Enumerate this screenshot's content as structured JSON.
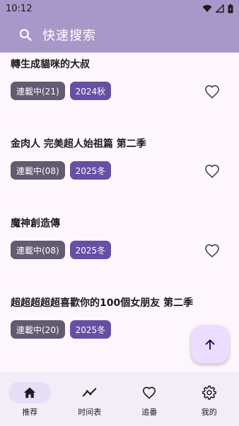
{
  "status_bar": {
    "time": "10:12"
  },
  "app_bar": {
    "search_placeholder": "快速搜索"
  },
  "anime_list": [
    {
      "title": "轉生成貓咪的大叔",
      "status": "連載中(21)",
      "season": "2024秋"
    },
    {
      "title": "金肉人 完美超人始祖篇 第二季",
      "status": "連載中(08)",
      "season": "2025冬"
    },
    {
      "title": "魔神創造傳",
      "status": "連載中(08)",
      "season": "2025冬"
    },
    {
      "title": "超超超超超喜歡你的100個女朋友 第二季",
      "status": "連載中(20)",
      "season": "2025冬"
    }
  ],
  "bottom_nav": [
    {
      "label": "推荐",
      "icon": "home-icon",
      "active": true
    },
    {
      "label": "时间表",
      "icon": "timeline-icon",
      "active": false
    },
    {
      "label": "追番",
      "icon": "heart-icon",
      "active": false
    },
    {
      "label": "我的",
      "icon": "gear-icon",
      "active": false
    }
  ],
  "colors": {
    "app_bar": "#a897c9",
    "status_chip": "#625b71",
    "season_chip": "#6750a4",
    "fab": "#eaddff",
    "background": "#fdf7fd"
  }
}
